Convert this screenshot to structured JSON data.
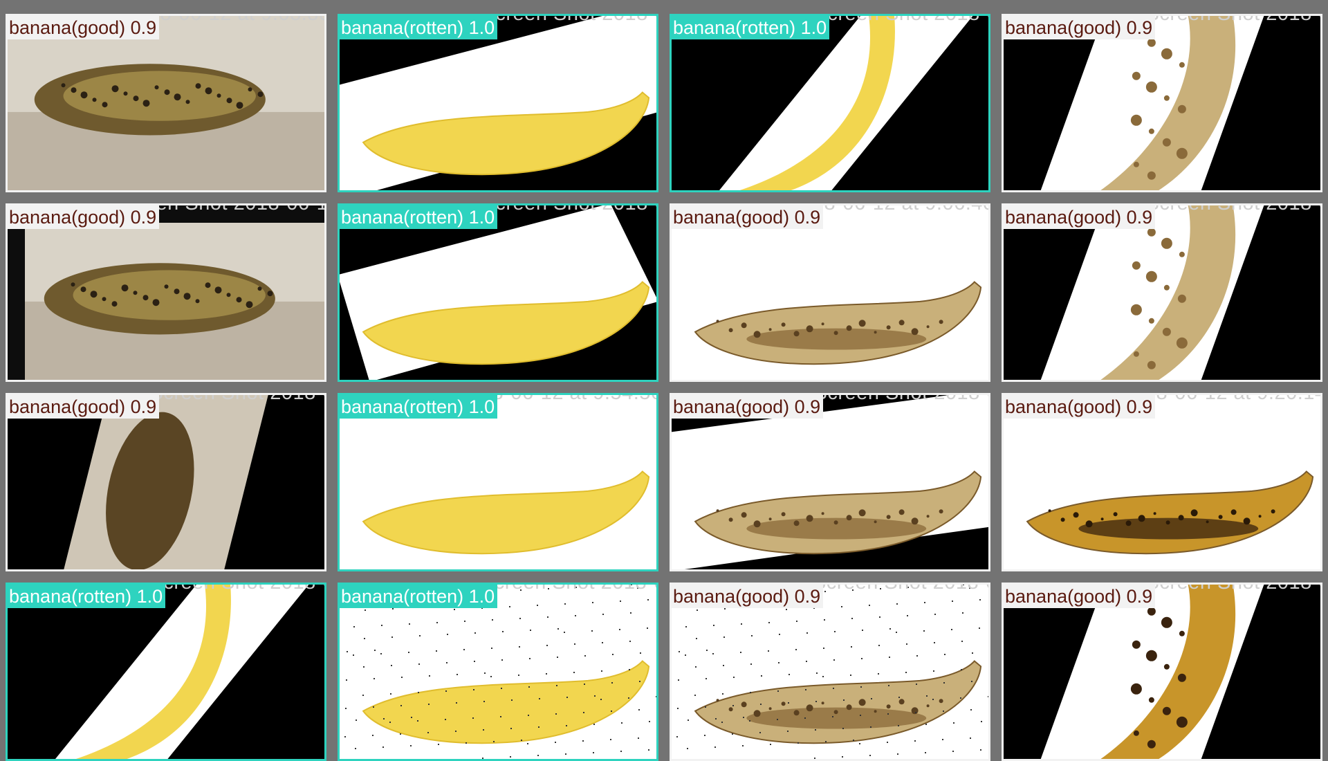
{
  "colors": {
    "grid_bg": "#737373",
    "good_label_bg": "#f2f2f2",
    "good_text": "#5a1a10",
    "rotten": "#2ed3bf"
  },
  "cells": [
    {
      "filename": "Screen Shot 2018-06-12 at 9.03.30 PM",
      "label": "banana(good) 0.9",
      "class": "good",
      "scene": "flat-brown-photo"
    },
    {
      "filename": "rotated_by_15_Screen Shot 2018-06-12",
      "label": "banana(rotten) 1.0",
      "class": "rotten",
      "scene": "yellow-tilt-white"
    },
    {
      "filename": "rotated_by_60_Screen Shot 2018-06-12",
      "label": "banana(rotten) 1.0",
      "class": "rotten",
      "scene": "yellow-diagonal-black"
    },
    {
      "filename": "rotated_by_75_Screen Shot 2018-06",
      "label": "banana(good) 0.9",
      "class": "good",
      "scene": "brown-diagonal-black"
    },
    {
      "filename": "translation_Screen Shot 2018-06-12",
      "label": "banana(good) 0.9",
      "class": "good",
      "scene": "flat-brown-photo-shifted"
    },
    {
      "filename": "rotated_by_30_Screen Shot 2018-06-12",
      "label": "banana(rotten) 1.0",
      "class": "rotten",
      "scene": "yellow-tilt-black"
    },
    {
      "filename": "Screen Shot 2018-06-12 at 9.06.40 PM",
      "label": "banana(good) 0.9",
      "class": "good",
      "scene": "brown-white"
    },
    {
      "filename": "rotated_by_60_Screen Shot 2018-06",
      "label": "banana(good) 0.9",
      "class": "good",
      "scene": "brown-diagonal-black"
    },
    {
      "filename": "rotated_by_45_Screen Shot 2018-06",
      "label": "banana(good) 0.9",
      "class": "good",
      "scene": "brown-rotated-photo"
    },
    {
      "filename": "Screen Shot 2018-06-12 at 9.54.56 PM",
      "label": "banana(rotten) 1.0",
      "class": "rotten",
      "scene": "yellow-white"
    },
    {
      "filename": "rotated_by_15_Screen Shot 2018-06",
      "label": "banana(good) 0.9",
      "class": "good",
      "scene": "brown-tilt-white"
    },
    {
      "filename": "Screen Shot 2018-06-12 at 9.20.14",
      "label": "banana(good) 0.9",
      "class": "good",
      "scene": "spotted-white"
    },
    {
      "filename": "rotated_by_45_Screen Shot 2018-06",
      "label": "banana(rotten) 1.0",
      "class": "rotten",
      "scene": "yellow-diagonal-black"
    },
    {
      "filename": "saltandpepper_Screen Shot 2018-06",
      "label": "banana(rotten) 1.0",
      "class": "rotten",
      "scene": "yellow-speckle"
    },
    {
      "filename": "saltandpepper_Screen Shot 2018-06",
      "label": "banana(good) 0.9",
      "class": "good",
      "scene": "brown-speckle"
    },
    {
      "filename": "rotated_by_75_Screen Shot 2018-06",
      "label": "banana(good) 0.9",
      "class": "good",
      "scene": "spotted-diagonal-black"
    }
  ]
}
